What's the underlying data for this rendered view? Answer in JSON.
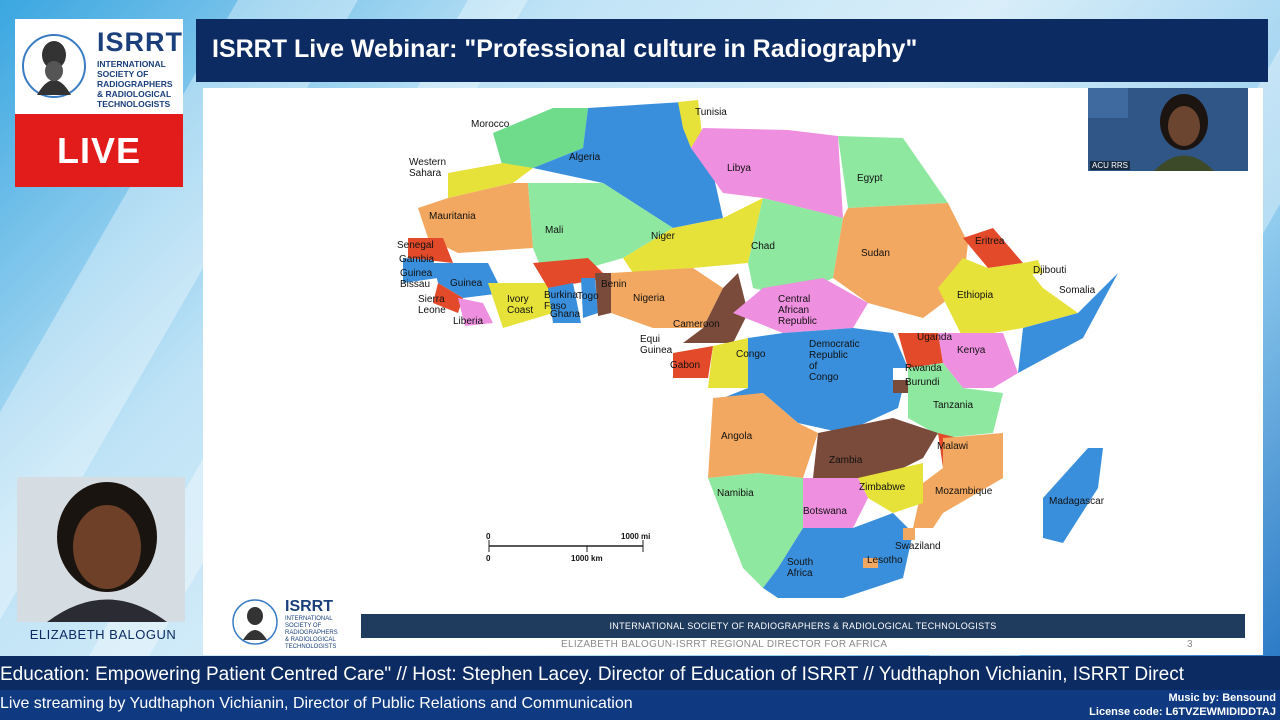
{
  "webinar_title": "ISRRT Live Webinar: \"Professional culture in Radiography\"",
  "live_label": "LIVE",
  "logo": {
    "name": "ISRRT",
    "subtitle": "INTERNATIONAL\nSOCIETY OF\nRADIOGRAPHERS\n& RADIOLOGICAL\nTECHNOLOGISTS"
  },
  "presenter": {
    "name": "ELIZABETH BALOGUN"
  },
  "webcam": {
    "label": "ACU RRS"
  },
  "slide": {
    "footer_bar": "INTERNATIONAL SOCIETY  OF  RADIOGRAPHERS & RADIOLOGICAL TECHNOLOGISTS",
    "footer_sub": "ELIZABETH BALOGUN-ISRRT REGIONAL DIRECTOR FOR AFRICA",
    "page_number": "3",
    "scale": {
      "zero_top": "0",
      "miles": "1000 mi",
      "zero_bottom": "0",
      "km": "1000 km"
    },
    "countries": {
      "morocco": "Morocco",
      "algeria": "Algeria",
      "tunisia": "Tunisia",
      "libya": "Libya",
      "egypt": "Egypt",
      "western_sahara_1": "Western",
      "western_sahara_2": "Sahara",
      "mauritania": "Mauritania",
      "mali": "Mali",
      "niger": "Niger",
      "chad": "Chad",
      "sudan": "Sudan",
      "eritrea": "Eritrea",
      "djibouti": "Djibouti",
      "ethiopia": "Ethiopia",
      "somalia": "Somalia",
      "senegal": "Senegal",
      "gambia": "Gambia",
      "guinea_bissau_1": "Guinea",
      "guinea_bissau_2": "Bissau",
      "guinea": "Guinea",
      "burkina_1": "Burkina",
      "burkina_2": "Faso",
      "benin": "Benin",
      "togo": "Togo",
      "nigeria": "Nigeria",
      "sierra_1": "Sierra",
      "sierra_2": "Leone",
      "ivory_1": "Ivory",
      "ivory_2": "Coast",
      "liberia": "Liberia",
      "ghana": "Ghana",
      "car_1": "Central",
      "car_2": "African",
      "car_3": "Republic",
      "cameroon": "Cameroon",
      "equi_1": "Equi",
      "equi_2": "Guinea",
      "gabon": "Gabon",
      "congo": "Congo",
      "drc_1": "Democratic",
      "drc_2": "Republic",
      "drc_3": "of",
      "drc_4": "Congo",
      "uganda": "Uganda",
      "kenya": "Kenya",
      "rwanda": "Rwanda",
      "burundi": "Burundi",
      "tanzania": "Tanzania",
      "angola": "Angola",
      "malawi": "Malawi",
      "zambia": "Zambia",
      "zimbabwe": "Zimbabwe",
      "mozambique": "Mozambique",
      "namibia": "Namibia",
      "botswana": "Botswana",
      "madagascar": "Madagascar",
      "swaziland": "Swaziland",
      "south_africa_1": "South",
      "south_africa_2": "Africa",
      "lesotho": "Lesotho"
    }
  },
  "ticker_main": "Education: Empowering Patient Centred Care\" // Host: Stephen Lacey. Director of Education of ISRRT // Yudthaphon Vichianin, ISRRT Direct",
  "ticker_sub": "Live streaming by Yudthaphon Vichianin, Director of Public Relations and Communication",
  "music": {
    "line1": "Music by: Bensound",
    "line2": "License code: L6TVZEWMIDIDDTAJ"
  },
  "colors": {
    "title_bar": "#0d2b63",
    "live_red": "#e21b1b",
    "ticker": "#0d2b63"
  }
}
